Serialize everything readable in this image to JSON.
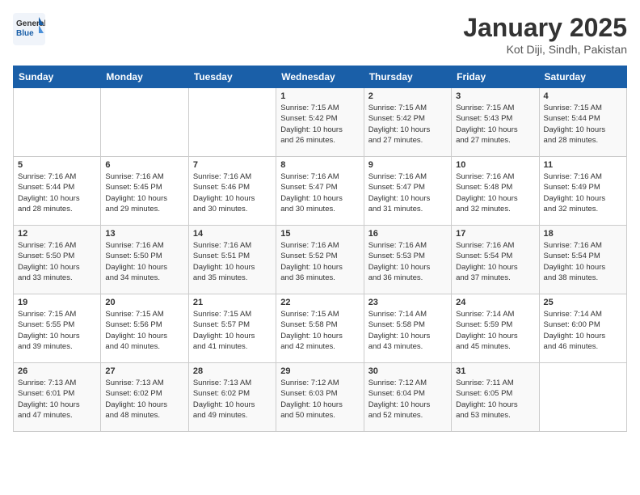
{
  "header": {
    "logo_general": "General",
    "logo_blue": "Blue",
    "title": "January 2025",
    "subtitle": "Kot Diji, Sindh, Pakistan"
  },
  "weekdays": [
    "Sunday",
    "Monday",
    "Tuesday",
    "Wednesday",
    "Thursday",
    "Friday",
    "Saturday"
  ],
  "weeks": [
    [
      {
        "day": "",
        "info": ""
      },
      {
        "day": "",
        "info": ""
      },
      {
        "day": "",
        "info": ""
      },
      {
        "day": "1",
        "info": "Sunrise: 7:15 AM\nSunset: 5:42 PM\nDaylight: 10 hours\nand 26 minutes."
      },
      {
        "day": "2",
        "info": "Sunrise: 7:15 AM\nSunset: 5:42 PM\nDaylight: 10 hours\nand 27 minutes."
      },
      {
        "day": "3",
        "info": "Sunrise: 7:15 AM\nSunset: 5:43 PM\nDaylight: 10 hours\nand 27 minutes."
      },
      {
        "day": "4",
        "info": "Sunrise: 7:15 AM\nSunset: 5:44 PM\nDaylight: 10 hours\nand 28 minutes."
      }
    ],
    [
      {
        "day": "5",
        "info": "Sunrise: 7:16 AM\nSunset: 5:44 PM\nDaylight: 10 hours\nand 28 minutes."
      },
      {
        "day": "6",
        "info": "Sunrise: 7:16 AM\nSunset: 5:45 PM\nDaylight: 10 hours\nand 29 minutes."
      },
      {
        "day": "7",
        "info": "Sunrise: 7:16 AM\nSunset: 5:46 PM\nDaylight: 10 hours\nand 30 minutes."
      },
      {
        "day": "8",
        "info": "Sunrise: 7:16 AM\nSunset: 5:47 PM\nDaylight: 10 hours\nand 30 minutes."
      },
      {
        "day": "9",
        "info": "Sunrise: 7:16 AM\nSunset: 5:47 PM\nDaylight: 10 hours\nand 31 minutes."
      },
      {
        "day": "10",
        "info": "Sunrise: 7:16 AM\nSunset: 5:48 PM\nDaylight: 10 hours\nand 32 minutes."
      },
      {
        "day": "11",
        "info": "Sunrise: 7:16 AM\nSunset: 5:49 PM\nDaylight: 10 hours\nand 32 minutes."
      }
    ],
    [
      {
        "day": "12",
        "info": "Sunrise: 7:16 AM\nSunset: 5:50 PM\nDaylight: 10 hours\nand 33 minutes."
      },
      {
        "day": "13",
        "info": "Sunrise: 7:16 AM\nSunset: 5:50 PM\nDaylight: 10 hours\nand 34 minutes."
      },
      {
        "day": "14",
        "info": "Sunrise: 7:16 AM\nSunset: 5:51 PM\nDaylight: 10 hours\nand 35 minutes."
      },
      {
        "day": "15",
        "info": "Sunrise: 7:16 AM\nSunset: 5:52 PM\nDaylight: 10 hours\nand 36 minutes."
      },
      {
        "day": "16",
        "info": "Sunrise: 7:16 AM\nSunset: 5:53 PM\nDaylight: 10 hours\nand 36 minutes."
      },
      {
        "day": "17",
        "info": "Sunrise: 7:16 AM\nSunset: 5:54 PM\nDaylight: 10 hours\nand 37 minutes."
      },
      {
        "day": "18",
        "info": "Sunrise: 7:16 AM\nSunset: 5:54 PM\nDaylight: 10 hours\nand 38 minutes."
      }
    ],
    [
      {
        "day": "19",
        "info": "Sunrise: 7:15 AM\nSunset: 5:55 PM\nDaylight: 10 hours\nand 39 minutes."
      },
      {
        "day": "20",
        "info": "Sunrise: 7:15 AM\nSunset: 5:56 PM\nDaylight: 10 hours\nand 40 minutes."
      },
      {
        "day": "21",
        "info": "Sunrise: 7:15 AM\nSunset: 5:57 PM\nDaylight: 10 hours\nand 41 minutes."
      },
      {
        "day": "22",
        "info": "Sunrise: 7:15 AM\nSunset: 5:58 PM\nDaylight: 10 hours\nand 42 minutes."
      },
      {
        "day": "23",
        "info": "Sunrise: 7:14 AM\nSunset: 5:58 PM\nDaylight: 10 hours\nand 43 minutes."
      },
      {
        "day": "24",
        "info": "Sunrise: 7:14 AM\nSunset: 5:59 PM\nDaylight: 10 hours\nand 45 minutes."
      },
      {
        "day": "25",
        "info": "Sunrise: 7:14 AM\nSunset: 6:00 PM\nDaylight: 10 hours\nand 46 minutes."
      }
    ],
    [
      {
        "day": "26",
        "info": "Sunrise: 7:13 AM\nSunset: 6:01 PM\nDaylight: 10 hours\nand 47 minutes."
      },
      {
        "day": "27",
        "info": "Sunrise: 7:13 AM\nSunset: 6:02 PM\nDaylight: 10 hours\nand 48 minutes."
      },
      {
        "day": "28",
        "info": "Sunrise: 7:13 AM\nSunset: 6:02 PM\nDaylight: 10 hours\nand 49 minutes."
      },
      {
        "day": "29",
        "info": "Sunrise: 7:12 AM\nSunset: 6:03 PM\nDaylight: 10 hours\nand 50 minutes."
      },
      {
        "day": "30",
        "info": "Sunrise: 7:12 AM\nSunset: 6:04 PM\nDaylight: 10 hours\nand 52 minutes."
      },
      {
        "day": "31",
        "info": "Sunrise: 7:11 AM\nSunset: 6:05 PM\nDaylight: 10 hours\nand 53 minutes."
      },
      {
        "day": "",
        "info": ""
      }
    ]
  ]
}
